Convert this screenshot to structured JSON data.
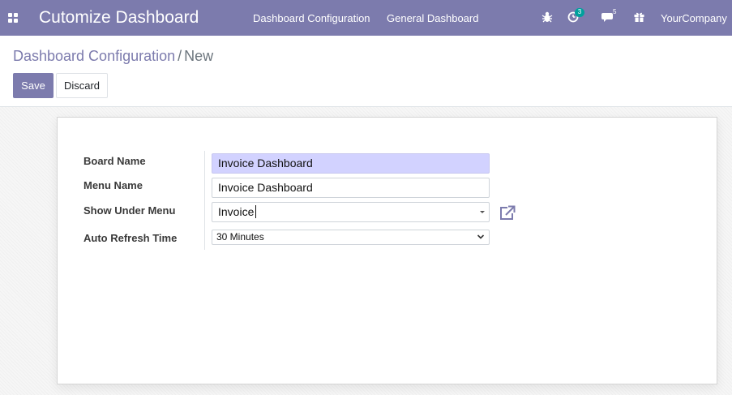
{
  "navbar": {
    "app_title": "Cutomize Dashboard",
    "menus": [
      "Dashboard Configuration",
      "General Dashboard"
    ],
    "activity_count": "3",
    "messages_count": "5",
    "company": "YourCompany"
  },
  "breadcrumb": {
    "parent": "Dashboard Configuration",
    "separator": "/",
    "current": "New"
  },
  "buttons": {
    "save": "Save",
    "discard": "Discard"
  },
  "form": {
    "board_name_label": "Board Name",
    "board_name_value": "Invoice Dashboard",
    "menu_name_label": "Menu Name",
    "menu_name_value": "Invoice Dashboard",
    "show_under_menu_label": "Show Under Menu",
    "show_under_menu_value": "Invoice",
    "auto_refresh_label": "Auto Refresh Time",
    "auto_refresh_value": "30 Minutes"
  },
  "colors": {
    "brand": "#7c7bad",
    "required_field": "#d2d2ff",
    "badge": "#00a09d"
  }
}
